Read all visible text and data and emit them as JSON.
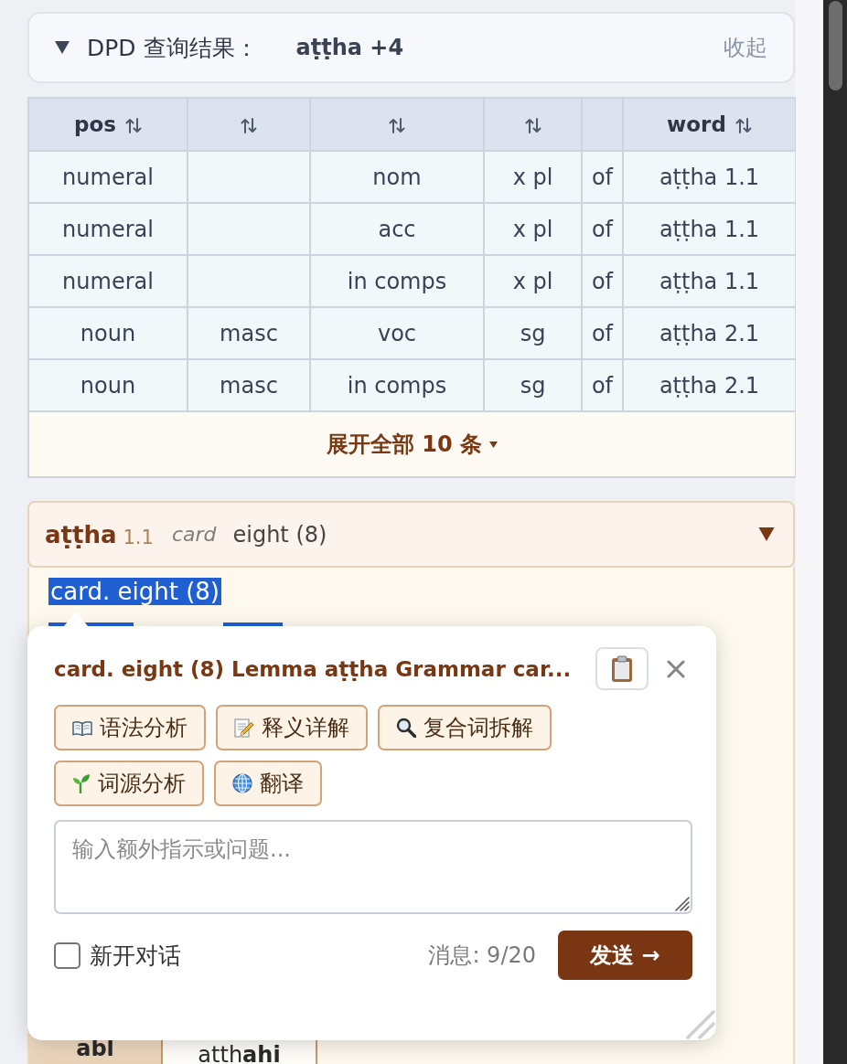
{
  "results_header": {
    "expanded": true,
    "title": "DPD 查询结果：",
    "query": "aṭṭha +4",
    "collapse_label": "收起"
  },
  "table": {
    "columns": [
      {
        "label": "pos",
        "sortable": true
      },
      {
        "sortable": true
      },
      {
        "sortable": true
      },
      {
        "sortable": true
      },
      {
        "sortable": false
      },
      {
        "label": "word",
        "sortable": true
      }
    ],
    "rows": [
      {
        "cells": [
          "numeral",
          null,
          "nom",
          "x pl",
          "of",
          "aṭṭha 1.1"
        ]
      },
      {
        "cells": [
          "numeral",
          null,
          "acc",
          "x pl",
          "of",
          "aṭṭha 1.1"
        ]
      },
      {
        "cells": [
          "numeral",
          null,
          "in comps",
          "x pl",
          "of",
          "aṭṭha 1.1"
        ]
      },
      {
        "cells": [
          "noun",
          "masc",
          "voc",
          "sg",
          "of",
          "aṭṭha 2.1"
        ]
      },
      {
        "cells": [
          "noun",
          "masc",
          "in comps",
          "sg",
          "of",
          "aṭṭha 2.1"
        ]
      }
    ],
    "expand_label": "展开全部 10 条"
  },
  "entry": {
    "lemma": "aṭṭha",
    "homonym": "1.1",
    "pos": "card",
    "meaning": "eight (8)",
    "expanded": true,
    "definition": {
      "text": "card. eight (8)",
      "selected": true
    },
    "grammar_cells": [
      {
        "kind": "header",
        "text": "abl"
      },
      {
        "kind": "form",
        "text": "atth**ahi**"
      }
    ]
  },
  "popup": {
    "title": "card. eight (8) Lemma aṭṭha Grammar car...",
    "actions": [
      {
        "kind": "grammar",
        "label": "语法分析"
      },
      {
        "kind": "definition",
        "label": "释义详解"
      },
      {
        "kind": "compound",
        "label": "复合词拆解"
      },
      {
        "kind": "etymology",
        "label": "词源分析"
      },
      {
        "kind": "translation",
        "label": "翻译"
      }
    ],
    "input": {
      "placeholder": "输入额外指示或问题..."
    },
    "new_chat": {
      "label": "新开对话",
      "checked": false
    },
    "message_count": "消息: 9/20",
    "send_label": "发送 →"
  }
}
